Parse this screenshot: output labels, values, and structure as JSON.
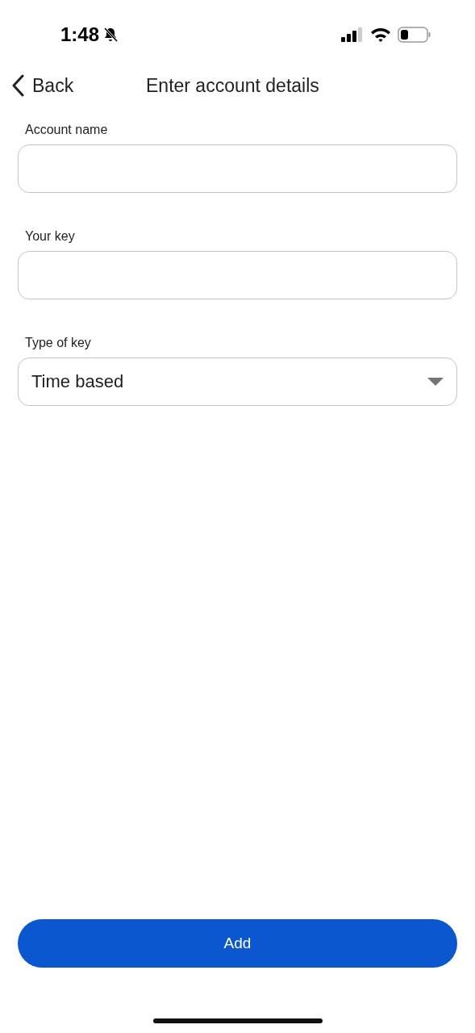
{
  "status_bar": {
    "time": "1:48",
    "silent": true
  },
  "nav": {
    "back": "Back",
    "title": "Enter account details"
  },
  "fields": [
    {
      "kind": "text",
      "label": "Account name"
    },
    {
      "kind": "text",
      "label": "Your key"
    },
    {
      "kind": "select",
      "label": "Type of key",
      "value": "Time based"
    }
  ],
  "button": "Add"
}
